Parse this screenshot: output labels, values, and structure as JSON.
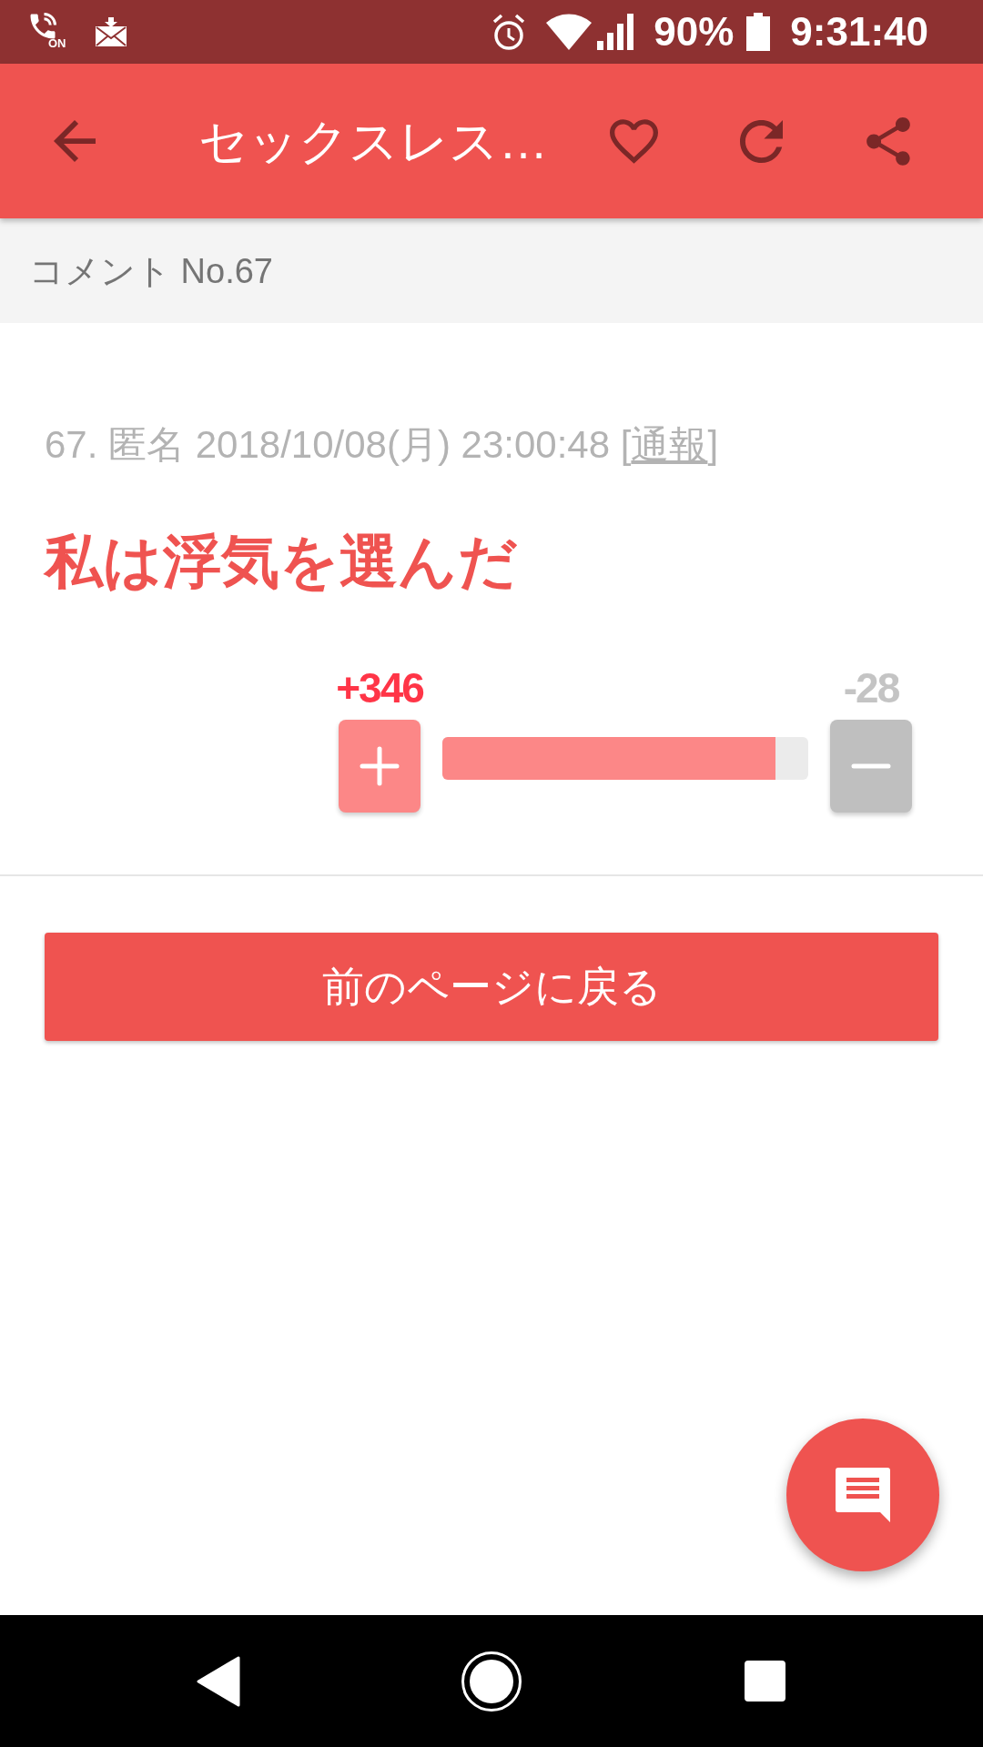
{
  "status_bar": {
    "call_label": "ON",
    "battery": "90%",
    "time": "9:31:40"
  },
  "app_bar": {
    "title": "セックスレス…"
  },
  "section_header": {
    "title": "コメント No.67"
  },
  "comment": {
    "meta": "67. 匿名 2018/10/08(月) 23:00:48 [",
    "report_link": "通報",
    "meta_end": "]",
    "body": "私は浮気を選んだ",
    "votes": {
      "plus": "+346",
      "minus": "-28",
      "level": 0.91
    }
  },
  "back_button": {
    "label": "前のページに戻る"
  }
}
